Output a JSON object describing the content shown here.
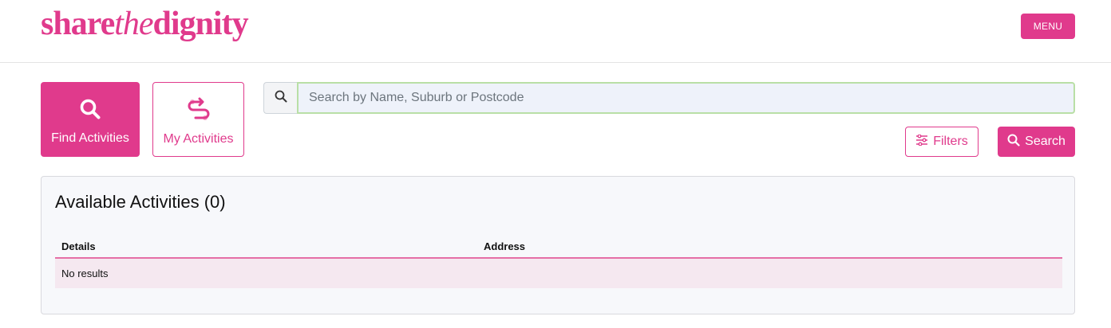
{
  "header": {
    "logo": {
      "part1": "share",
      "part2": "the",
      "part3": "dignity"
    },
    "menu_label": "MENU"
  },
  "tiles": {
    "find": {
      "label": "Find Activities",
      "icon": "search-icon"
    },
    "my": {
      "label": "My Activities",
      "icon": "route-icon"
    }
  },
  "search": {
    "placeholder": "Search by Name, Suburb or Postcode",
    "value": "",
    "icon": "search-icon"
  },
  "actions": {
    "filters_label": "Filters",
    "filters_icon": "sliders-icon",
    "search_label": "Search",
    "search_icon": "search-icon"
  },
  "results": {
    "title": "Available Activities (0)",
    "columns": [
      "Details",
      "Address"
    ],
    "empty_text": "No results"
  },
  "colors": {
    "brand": "#e03a8c",
    "row_bg": "#f5e8f0",
    "input_bg": "#eef2fa",
    "input_border": "#b9dfa6"
  }
}
